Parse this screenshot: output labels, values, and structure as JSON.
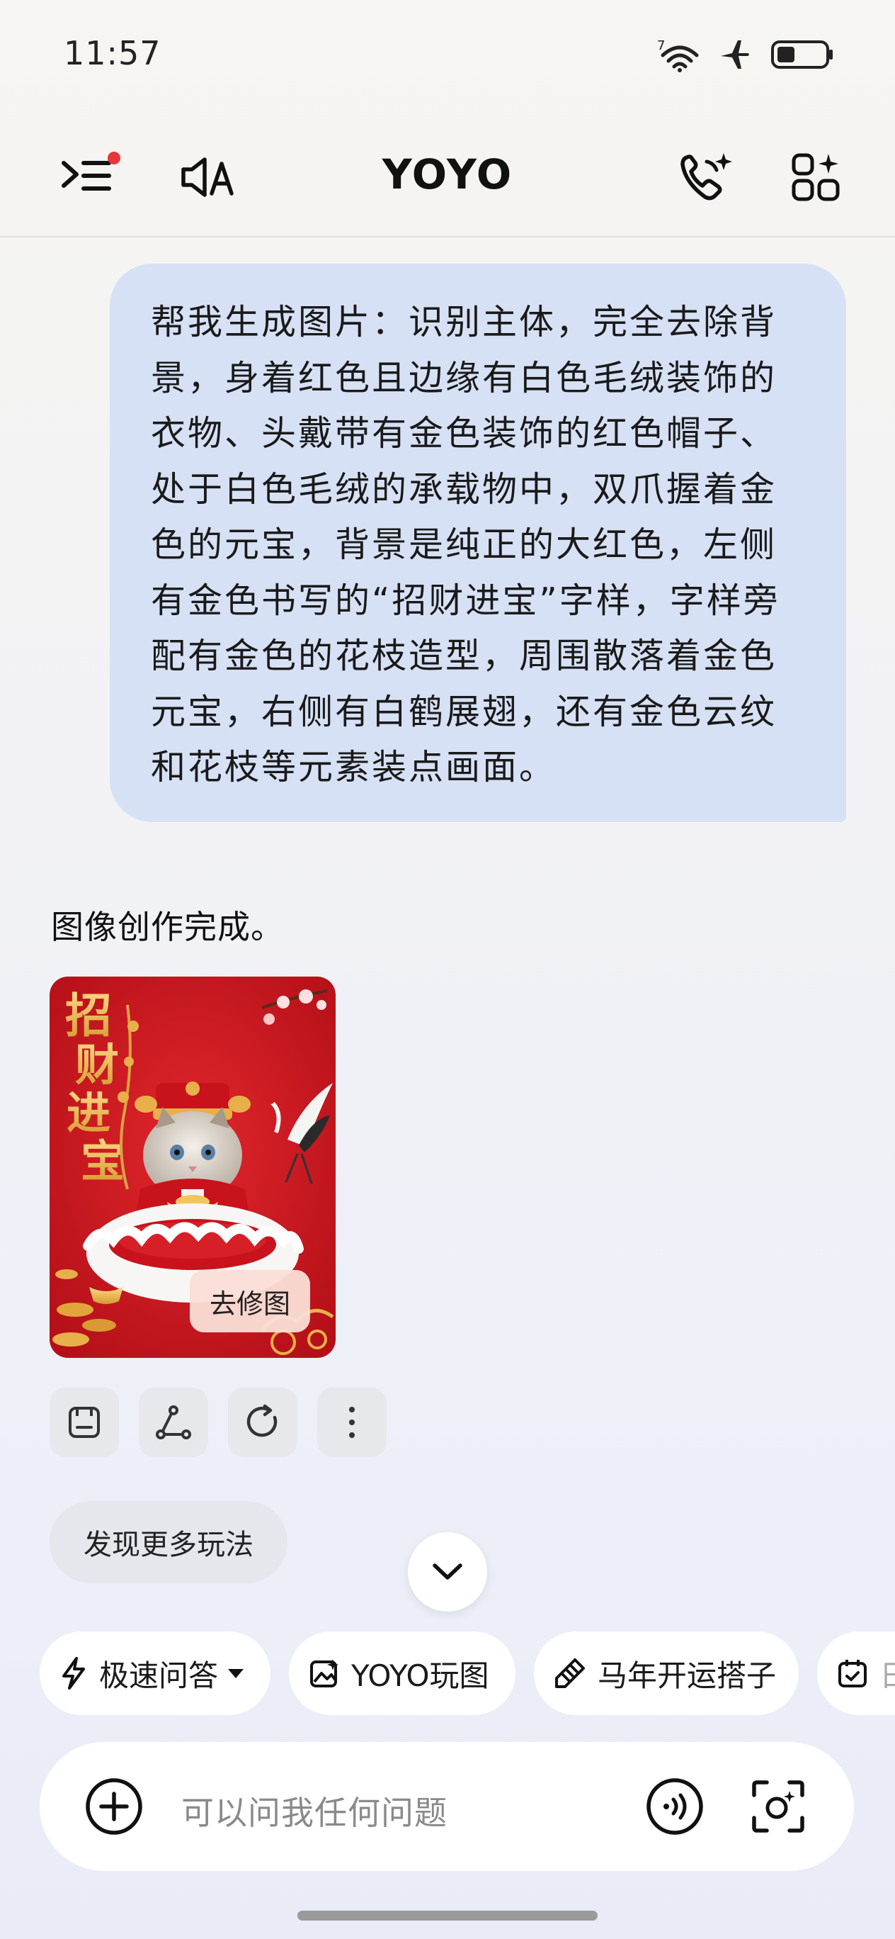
{
  "status_bar": {
    "time": "11:57",
    "network": "7"
  },
  "header": {
    "title": "YOYO"
  },
  "conversation": {
    "user_message_lines": [
      "帮我生成图片：识别主体，完全去除背",
      "景，身着红色且边缘有白色毛绒装饰的",
      "衣物、头戴带有金色装饰的红色帽子、",
      "处于白色毛绒的承载物中，双爪握着金",
      "色的元宝，背景是纯正的大红色，左侧",
      "有金色书写的“招财进宝”字样，字样旁",
      "配有金色的花枝造型，周围散落着金色",
      "元宝，右侧有白鹤展翅，还有金色云纹",
      "和花枝等元素装点画面。"
    ],
    "reply_text": "图像创作完成。",
    "image_text": [
      "招",
      "财",
      "进",
      "宝"
    ],
    "edit_image_label": "去修图",
    "discover_more_label": "发现更多玩法"
  },
  "chips": [
    {
      "label": "极速问答",
      "icon": "lightning-icon"
    },
    {
      "label": "YOYO玩图",
      "icon": "image-sparkle-icon"
    },
    {
      "label": "马年开运搭子",
      "icon": "pen-icon"
    },
    {
      "label": "日",
      "icon": "calendar-icon"
    }
  ],
  "input": {
    "placeholder": "可以问我任何问题"
  },
  "colors": {
    "bubble": "#d7e1f5",
    "accent_red": "#e8373b",
    "poster_red": "#c8131c",
    "gold": "#e8b04a"
  }
}
